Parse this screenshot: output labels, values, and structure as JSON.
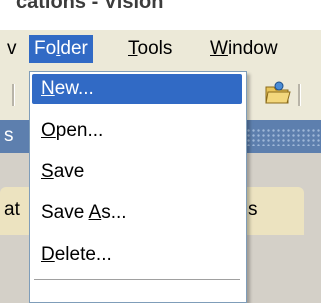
{
  "window": {
    "title_fragment": "cations - Vision"
  },
  "menubar": {
    "items": [
      {
        "key": "view",
        "label": "v",
        "underline": ""
      },
      {
        "key": "folder",
        "pre": "Fo",
        "underline": "l",
        "post": "der",
        "active": true
      },
      {
        "key": "tools",
        "pre": "",
        "underline": "T",
        "post": "ools"
      },
      {
        "key": "window",
        "pre": "",
        "underline": "W",
        "post": "indow"
      }
    ]
  },
  "toolbar": {
    "icons": [
      "folder-icon"
    ]
  },
  "bluebar": {
    "label": "s"
  },
  "tabs": [
    {
      "label": "at"
    },
    {
      "label": "s"
    }
  ],
  "folder_menu": {
    "items": [
      {
        "key": "new",
        "pre": "",
        "underline": "N",
        "post": "ew...",
        "highlighted": true
      },
      {
        "key": "open",
        "pre": "",
        "underline": "O",
        "post": "pen..."
      },
      {
        "key": "save",
        "pre": "",
        "underline": "S",
        "post": "ave"
      },
      {
        "key": "save_as",
        "pre": "Save ",
        "underline": "A",
        "post": "s..."
      },
      {
        "key": "delete",
        "pre": "",
        "underline": "D",
        "post": "elete..."
      }
    ]
  },
  "colors": {
    "highlight": "#316ac5",
    "menubar_bg": "#ece9d8",
    "bluebar": "#5d7fae",
    "tab_bg": "#ece3c0"
  }
}
